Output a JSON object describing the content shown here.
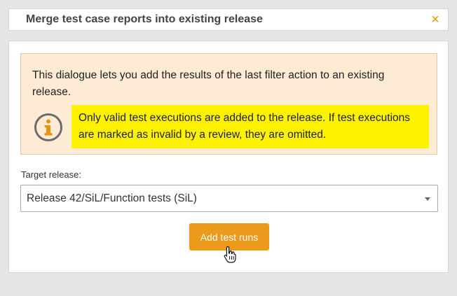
{
  "header": {
    "title": "Merge test case reports into existing release",
    "close_icon": "×"
  },
  "info": {
    "description": "This dialogue lets you add the results of the last filter action to an existing release.",
    "warning": "Only valid test executions are added to the release. If test executions are marked as invalid by a review, they are omitted.",
    "icon": "info-icon"
  },
  "form": {
    "target_label": "Target release:",
    "target_value": "Release 42/SiL/Function tests (SiL)"
  },
  "actions": {
    "submit_label": "Add test runs"
  },
  "colors": {
    "accent": "#eb9a1c",
    "info_bg": "#fdebd3",
    "highlight": "#fff200"
  }
}
